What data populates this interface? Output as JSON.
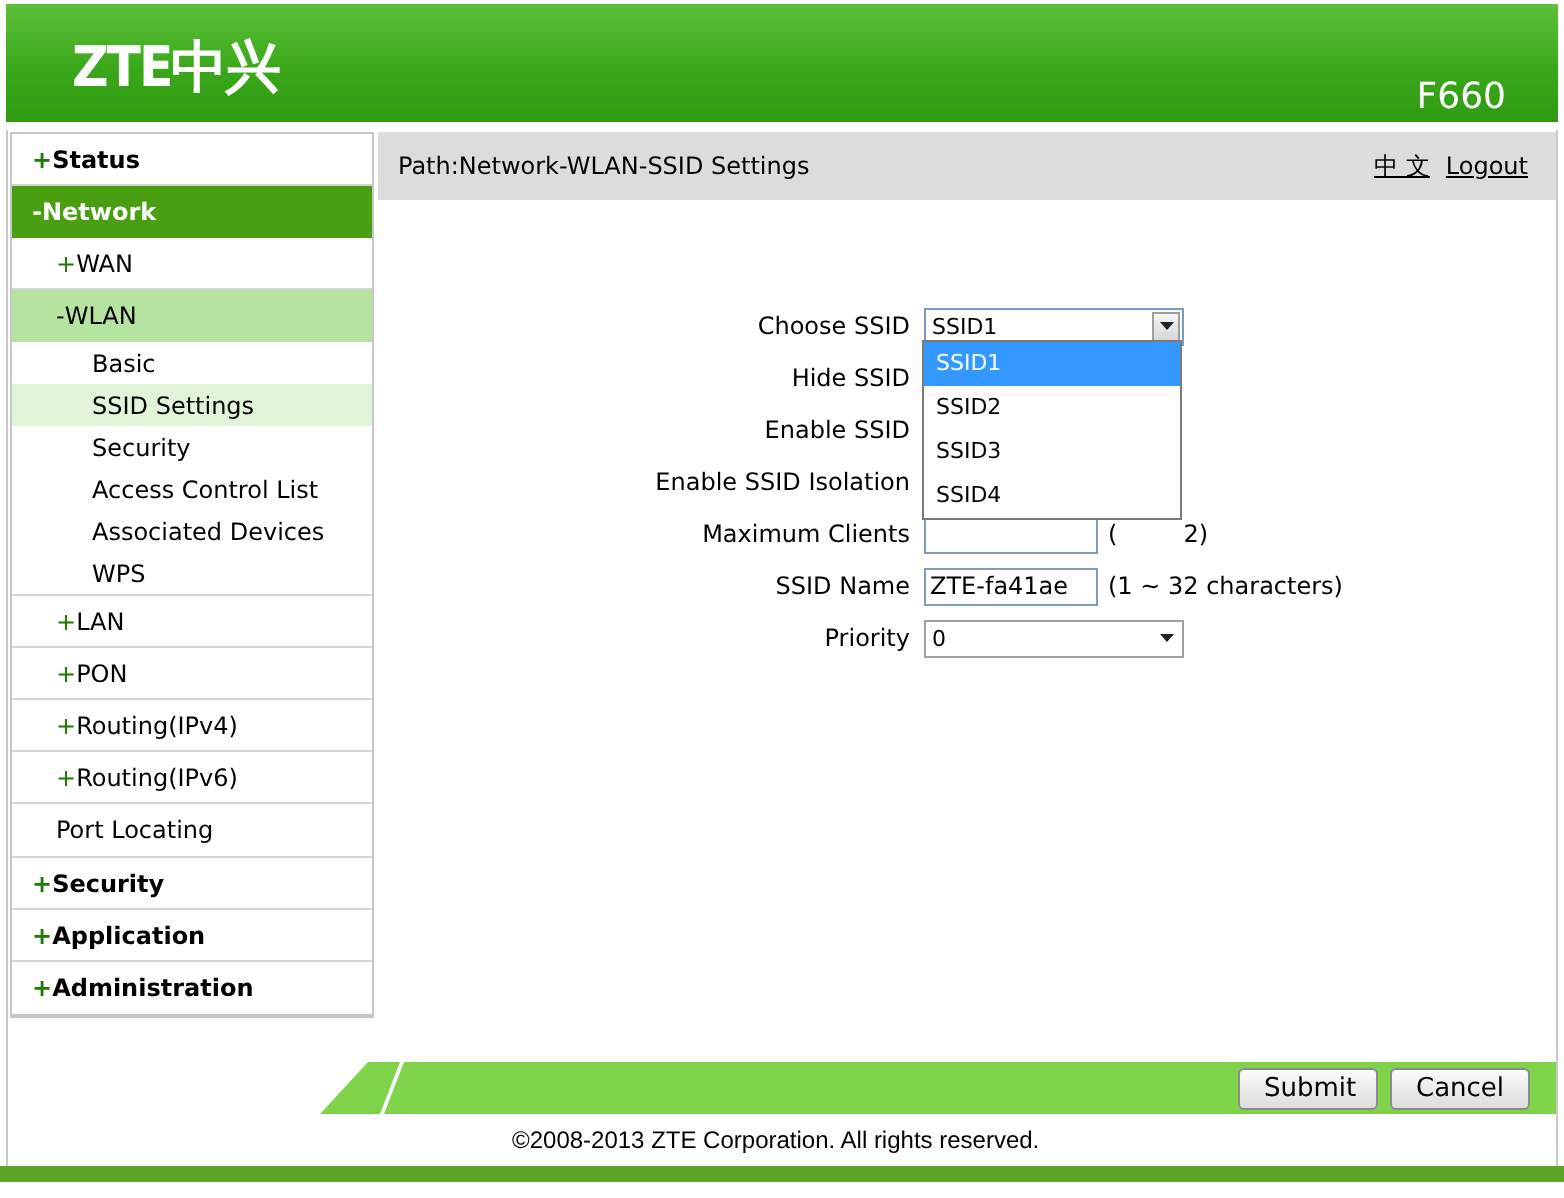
{
  "header": {
    "logo": "ZTE中兴",
    "model": "F660"
  },
  "sidebar": {
    "items": [
      {
        "sign": "+",
        "label": "Status",
        "selected": false
      },
      {
        "sign": "-",
        "label": "Network",
        "selected": true,
        "children": [
          {
            "sign": "+",
            "label": "WAN",
            "selected": false
          },
          {
            "sign": "-",
            "label": "WLAN",
            "selected": true,
            "children": [
              {
                "label": "Basic",
                "selected": false
              },
              {
                "label": "SSID Settings",
                "selected": true
              },
              {
                "label": "Security",
                "selected": false
              },
              {
                "label": "Access Control List",
                "selected": false
              },
              {
                "label": "Associated Devices",
                "selected": false
              },
              {
                "label": "WPS",
                "selected": false
              }
            ]
          },
          {
            "sign": "+",
            "label": "LAN",
            "selected": false
          },
          {
            "sign": "+",
            "label": "PON",
            "selected": false
          },
          {
            "sign": "+",
            "label": "Routing(IPv4)",
            "selected": false
          },
          {
            "sign": "+",
            "label": "Routing(IPv6)",
            "selected": false
          },
          {
            "label": "Port Locating",
            "selected": false
          }
        ]
      },
      {
        "sign": "+",
        "label": "Security",
        "selected": false
      },
      {
        "sign": "+",
        "label": "Application",
        "selected": false
      },
      {
        "sign": "+",
        "label": "Administration",
        "selected": false
      }
    ]
  },
  "path_bar": {
    "path": "Path:Network-WLAN-SSID Settings",
    "links": [
      "中 文",
      "Logout"
    ]
  },
  "form": {
    "rows": [
      {
        "kind": "select",
        "label": "Choose SSID",
        "value": "SSID1",
        "open": true
      },
      {
        "kind": "covered",
        "label": "Hide SSID"
      },
      {
        "kind": "covered",
        "label": "Enable SSID"
      },
      {
        "kind": "covered",
        "label": "Enable SSID Isolation"
      },
      {
        "kind": "text",
        "label": "Maximum Clients",
        "hint_parts": [
          "(",
          "2)"
        ]
      },
      {
        "kind": "text",
        "label": "SSID Name",
        "value": "ZTE-fa41ae",
        "hint_parts": [
          "(1 ~ 32 characters)"
        ]
      },
      {
        "kind": "select",
        "label": "Priority",
        "value": "0",
        "open": false
      }
    ]
  },
  "dropdown": {
    "options": [
      {
        "label": "SSID1",
        "selected": true
      },
      {
        "label": "SSID2",
        "selected": false
      },
      {
        "label": "SSID3",
        "selected": false
      },
      {
        "label": "SSID4",
        "selected": false
      }
    ]
  },
  "buttons": [
    "Submit",
    "Cancel"
  ],
  "copyright": "©2008-2013 ZTE Corporation. All rights reserved."
}
